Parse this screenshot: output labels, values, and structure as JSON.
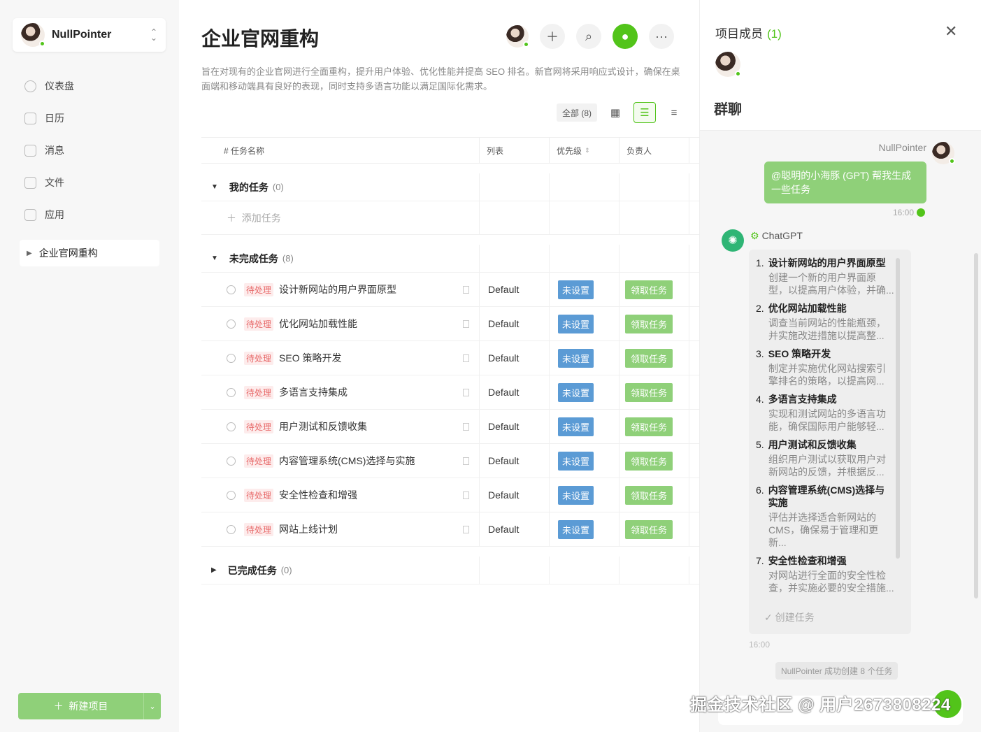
{
  "sidebar": {
    "user_name": "NullPointer",
    "nav": [
      "仪表盘",
      "日历",
      "消息",
      "文件",
      "应用"
    ],
    "project": "企业官网重构",
    "new_project": "新建项目"
  },
  "main": {
    "title": "企业官网重构",
    "description": "旨在对现有的企业官网进行全面重构，提升用户体验、优化性能并提高 SEO 排名。新官网将采用响应式设计，确保在桌面端和移动端具有良好的表现，同时支持多语言功能以满足国际化需求。",
    "filter_all": "全部 (8)",
    "columns": [
      "# 任务名称",
      "列表",
      "优先级",
      "负责人"
    ],
    "groups": {
      "mine": {
        "label": "我的任务",
        "count": "(0)",
        "add": "添加任务"
      },
      "todo": {
        "label": "未完成任务",
        "count": "(8)"
      },
      "done": {
        "label": "已完成任务",
        "count": "(0)"
      }
    },
    "tasks": [
      {
        "status": "待处理",
        "name": "设计新网站的用户界面原型",
        "list": "Default",
        "priority": "未设置",
        "owner": "领取任务"
      },
      {
        "status": "待处理",
        "name": "优化网站加载性能",
        "list": "Default",
        "priority": "未设置",
        "owner": "领取任务"
      },
      {
        "status": "待处理",
        "name": "SEO 策略开发",
        "list": "Default",
        "priority": "未设置",
        "owner": "领取任务"
      },
      {
        "status": "待处理",
        "name": "多语言支持集成",
        "list": "Default",
        "priority": "未设置",
        "owner": "领取任务"
      },
      {
        "status": "待处理",
        "name": "用户测试和反馈收集",
        "list": "Default",
        "priority": "未设置",
        "owner": "领取任务"
      },
      {
        "status": "待处理",
        "name": "内容管理系统(CMS)选择与实施",
        "list": "Default",
        "priority": "未设置",
        "owner": "领取任务"
      },
      {
        "status": "待处理",
        "name": "安全性检查和增强",
        "list": "Default",
        "priority": "未设置",
        "owner": "领取任务"
      },
      {
        "status": "待处理",
        "name": "网站上线计划",
        "list": "Default",
        "priority": "未设置",
        "owner": "领取任务"
      }
    ]
  },
  "panel": {
    "members_title": "项目成员",
    "members_count": "(1)",
    "group_chat": "群聊",
    "user_msg_name": "NullPointer",
    "user_msg": "@聪明的小海豚 (GPT) 帮我生成一些任务",
    "user_msg_time": "16:00",
    "bot_name": "ChatGPT",
    "bot_items": [
      {
        "num": "1.",
        "title": "设计新网站的用户界面原型",
        "desc": "创建一个新的用户界面原型，以提高用户体验，并确..."
      },
      {
        "num": "2.",
        "title": "优化网站加载性能",
        "desc": "调查当前网站的性能瓶颈，并实施改进措施以提高整..."
      },
      {
        "num": "3.",
        "title": "SEO 策略开发",
        "desc": "制定并实施优化网站搜索引擎排名的策略，以提高网..."
      },
      {
        "num": "4.",
        "title": "多语言支持集成",
        "desc": "实现和测试网站的多语言功能，确保国际用户能够轻..."
      },
      {
        "num": "5.",
        "title": "用户测试和反馈收集",
        "desc": "组织用户测试以获取用户对新网站的反馈，并根据反..."
      },
      {
        "num": "6.",
        "title": "内容管理系统(CMS)选择与实施",
        "desc": "评估并选择适合新网站的 CMS，确保易于管理和更新..."
      },
      {
        "num": "7.",
        "title": "安全性检查和增强",
        "desc": "对网站进行全面的安全性检查，并实施必要的安全措施..."
      }
    ],
    "create_task": "创建任务",
    "bot_time": "16:00",
    "system_msg": "NullPointer 成功创建 8 个任务",
    "watermark": "掘金技术社区 @ 用户2673808224"
  }
}
